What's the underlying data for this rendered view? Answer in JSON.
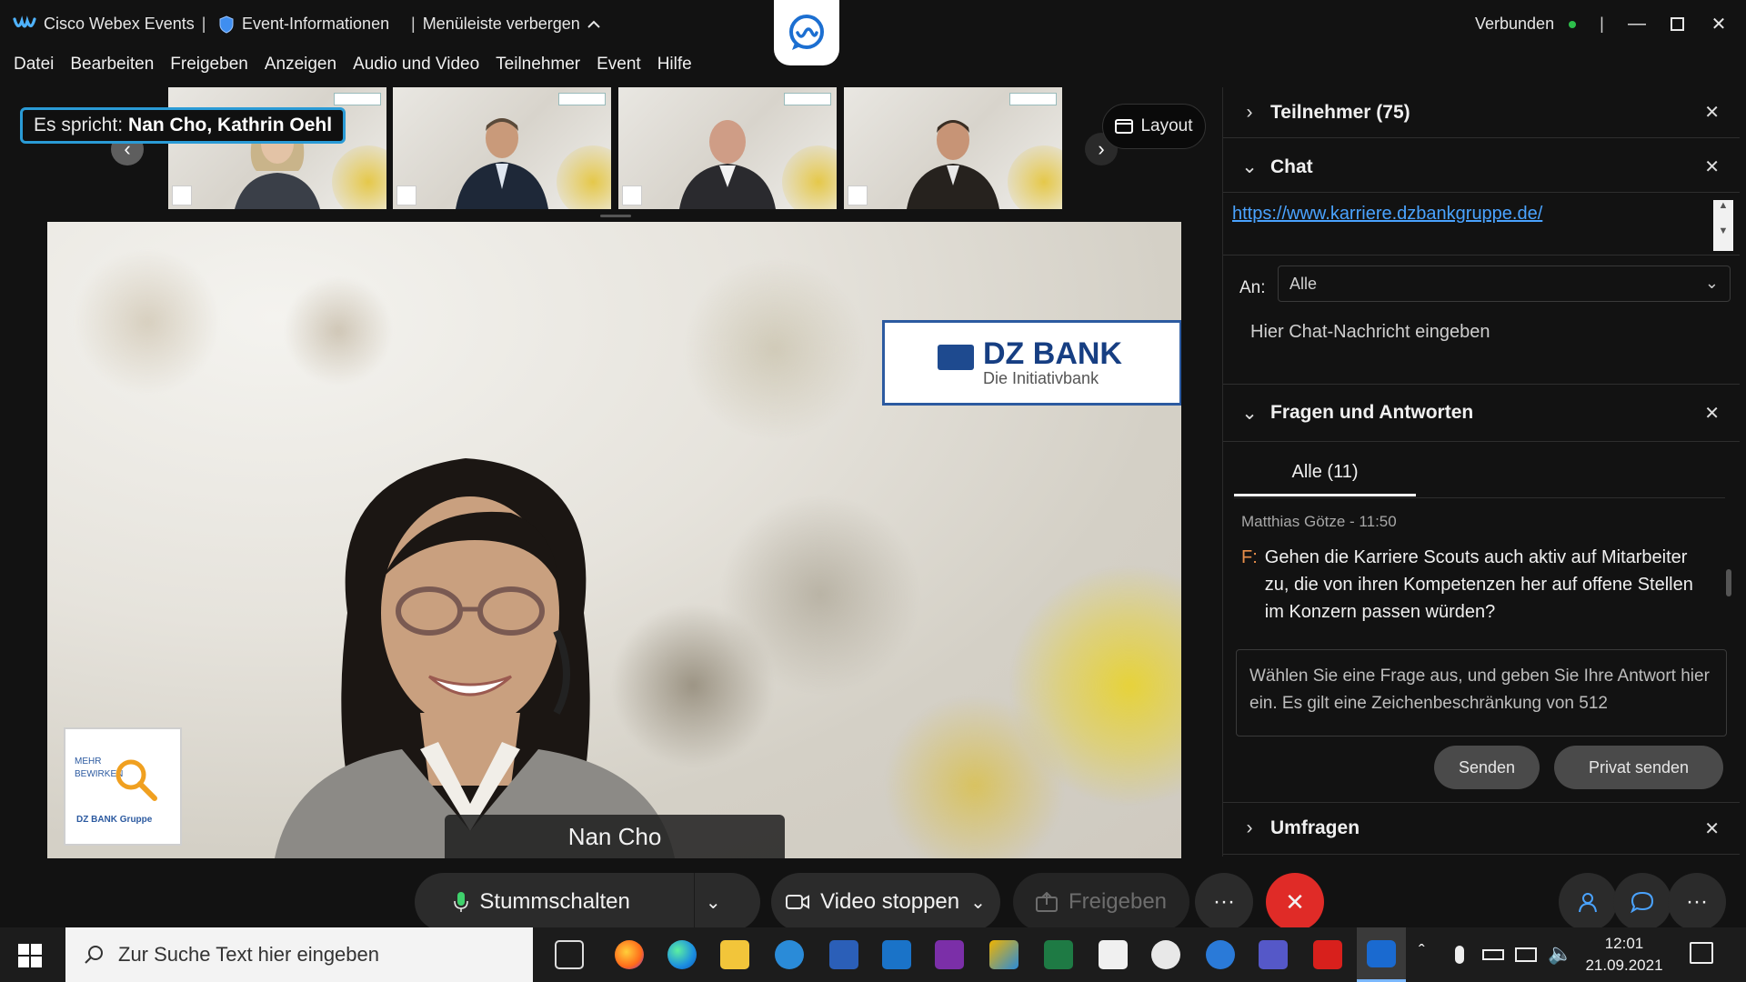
{
  "window": {
    "app_title": "Cisco Webex Events",
    "event_info": "Event-Informationen",
    "hide_menu": "Menüleiste verbergen",
    "status": "Verbunden",
    "status_color": "#2dbf4b"
  },
  "menu": [
    "Datei",
    "Bearbeiten",
    "Freigeben",
    "Anzeigen",
    "Audio und Video",
    "Teilnehmer",
    "Event",
    "Hilfe"
  ],
  "filmstrip": {
    "speaking_prefix": "Es spricht:",
    "speaking_names": "Nan Cho, Kathrin Oehl",
    "layout_label": "Layout"
  },
  "video": {
    "presenter_name": "Nan Cho",
    "sign_brand": "DZ BANK",
    "sign_tagline": "Die Initiativbank",
    "poster_text_1": "MEHR",
    "poster_text_2": "BEWIRKEN",
    "poster_text_3": "DZ BANK Gruppe"
  },
  "panel": {
    "participants": "Teilnehmer (75)",
    "chat": "Chat",
    "chat_link": "https://www.karriere.dzbankgruppe.de/",
    "to_label": "An:",
    "to_value": "Alle",
    "chat_placeholder": "Hier Chat-Nachricht eingeben",
    "qa": "Fragen und Antworten",
    "qa_tab": "Alle (11)",
    "qa_meta": "Matthias Götze - 11:50",
    "qa_prefix": "F:",
    "qa_question": "Gehen die Karriere Scouts auch aktiv auf Mitarbeiter zu, die von ihren Kompetenzen her auf offene Stellen im Konzern passen würden?",
    "qa_answer_placeholder": "Wählen Sie eine Frage aus, und geben Sie Ihre Antwort hier ein. Es gilt eine Zeichenbeschränkung von 512",
    "send": "Senden",
    "send_private": "Privat senden",
    "polls": "Umfragen"
  },
  "controls": {
    "mute": "Stummschalten",
    "video": "Video stoppen",
    "share": "Freigeben",
    "more": "···",
    "leave_color": "#e02b27"
  },
  "taskbar": {
    "search_placeholder": "Zur Suche Text hier eingeben",
    "time": "12:01",
    "date": "21.09.2021"
  }
}
